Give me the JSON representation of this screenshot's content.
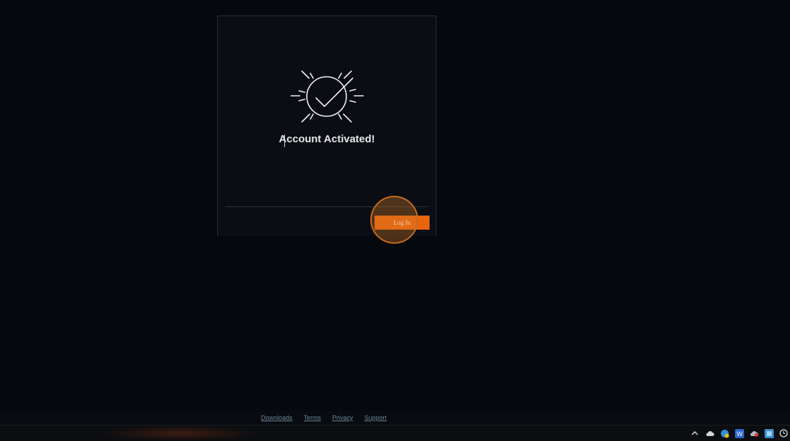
{
  "activation": {
    "title": "Account Activated!",
    "login_label": "Log In"
  },
  "footer": {
    "links": [
      "Downloads",
      "Terms",
      "Privacy",
      "Support"
    ]
  },
  "taskbar": {
    "tray_icons": [
      "chevron-up-icon",
      "cloud-icon",
      "network-icon",
      "word-icon",
      "cloud-sync-icon",
      "app-icon",
      "clock-icon"
    ]
  },
  "colors": {
    "accent": "#e8650e",
    "background": "#05080c",
    "card": "#0a0e14",
    "link": "#6d8598"
  }
}
